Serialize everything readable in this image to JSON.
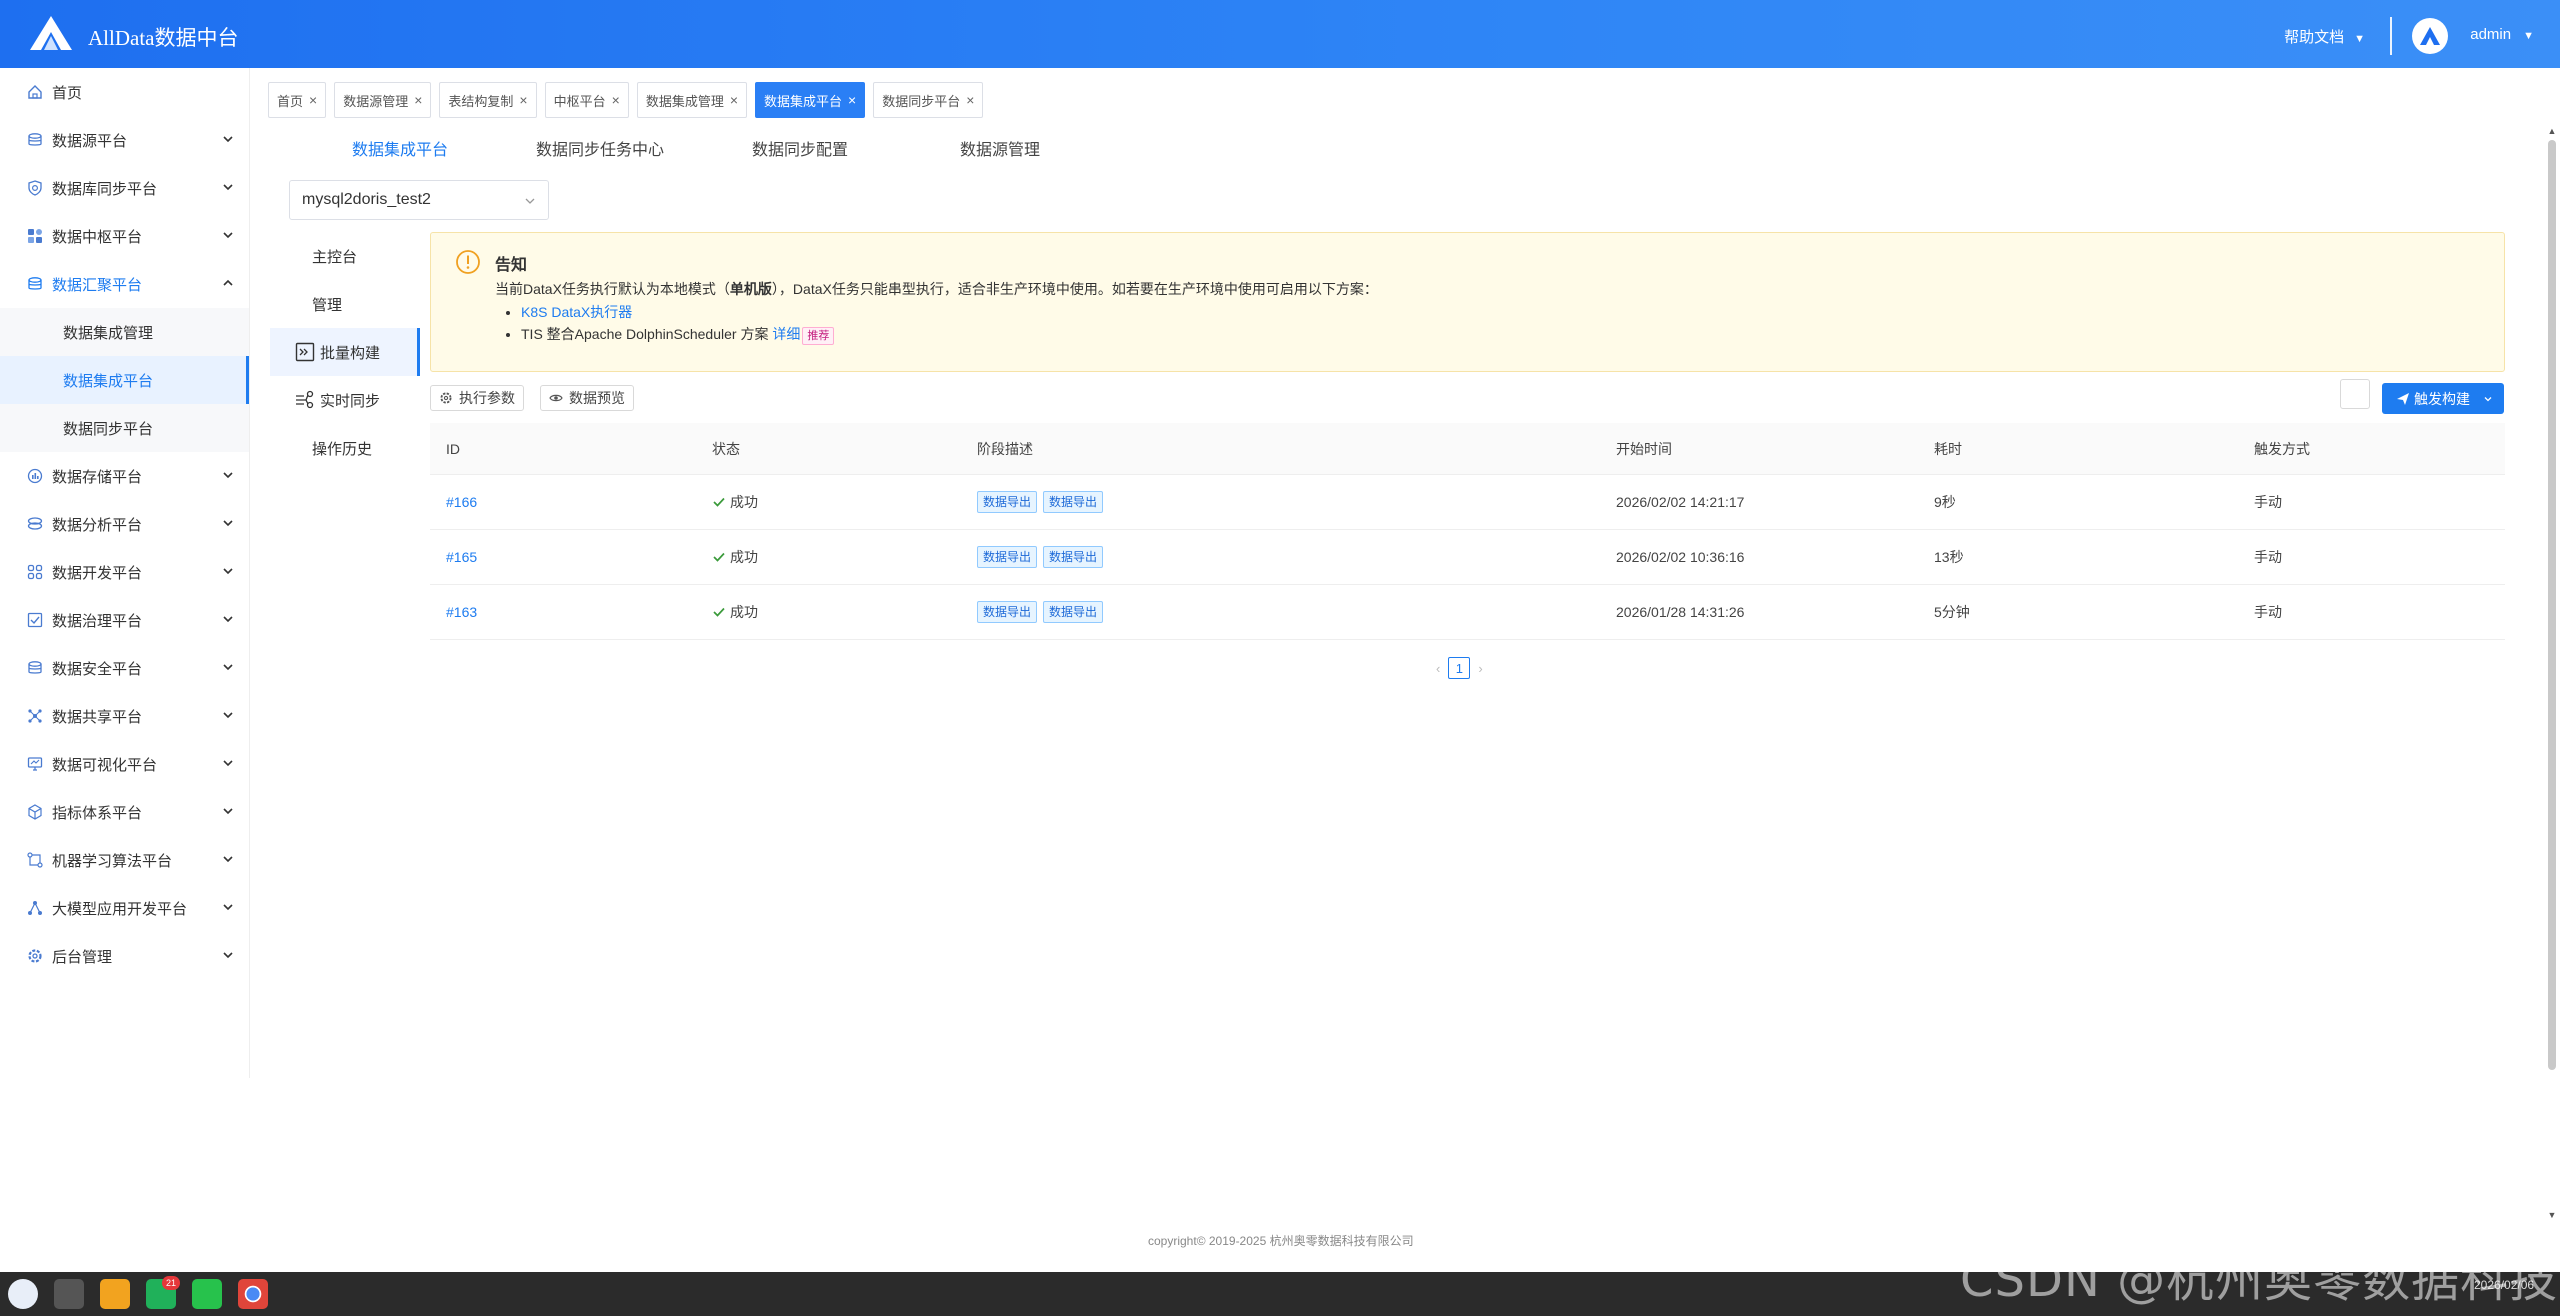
{
  "header": {
    "app_title": "AllData数据中台",
    "help_label": "帮助文档",
    "user_name": "admin"
  },
  "sidebar": {
    "items": [
      {
        "label": "首页",
        "icon": "home-icon"
      },
      {
        "label": "数据源平台",
        "icon": "database-icon"
      },
      {
        "label": "数据库同步平台",
        "icon": "sync-shield-icon"
      },
      {
        "label": "数据中枢平台",
        "icon": "hub-icon"
      },
      {
        "label": "数据汇聚平台",
        "icon": "database-icon",
        "expanded": true
      },
      {
        "label": "数据存储平台",
        "icon": "storage-icon"
      },
      {
        "label": "数据分析平台",
        "icon": "analysis-icon"
      },
      {
        "label": "数据开发平台",
        "icon": "grid-icon"
      },
      {
        "label": "数据治理平台",
        "icon": "checklist-icon"
      },
      {
        "label": "数据安全平台",
        "icon": "database-icon"
      },
      {
        "label": "数据共享平台",
        "icon": "share-icon"
      },
      {
        "label": "数据可视化平台",
        "icon": "monitor-icon"
      },
      {
        "label": "指标体系平台",
        "icon": "cube-icon"
      },
      {
        "label": "机器学习算法平台",
        "icon": "ml-icon"
      },
      {
        "label": "大模型应用开发平台",
        "icon": "llm-icon"
      },
      {
        "label": "后台管理",
        "icon": "settings-icon"
      }
    ],
    "subitems": [
      "数据集成管理",
      "数据集成平台",
      "数据同步平台"
    ]
  },
  "tags": [
    {
      "label": "首页"
    },
    {
      "label": "数据源管理"
    },
    {
      "label": "表结构复制"
    },
    {
      "label": "中枢平台"
    },
    {
      "label": "数据集成管理"
    },
    {
      "label": "数据集成平台",
      "active": true
    },
    {
      "label": "数据同步平台"
    }
  ],
  "top_tabs": [
    "数据集成平台",
    "数据同步任务中心",
    "数据同步配置",
    "数据源管理"
  ],
  "pipeline_select": {
    "value": "mysql2doris_test2"
  },
  "inner_nav": [
    "主控台",
    "管理",
    "批量构建",
    "实时同步",
    "操作历史"
  ],
  "notice": {
    "title": "告知",
    "text_a": "当前DataX任务执行默认为本地模式（",
    "text_bold": "单机版",
    "text_b": "），DataX任务只能串型执行，适合非生产环境中使用。如若要在生产环境中使用可启用以下方案：",
    "item1_link": "K8S DataX执行器",
    "item2_text": "TIS 整合Apache DolphinScheduler 方案",
    "item2_link": "详细",
    "item2_badge": "推荐"
  },
  "toolbar": {
    "exec_params": "执行参数",
    "data_preview": "数据预览",
    "trigger_build": "触发构建"
  },
  "table": {
    "headers": [
      "ID",
      "状态",
      "阶段描述",
      "开始时间",
      "耗时",
      "触发方式"
    ],
    "rows": [
      {
        "id": "#166",
        "status": "成功",
        "stages": [
          "数据导出",
          "数据导出"
        ],
        "start": "2026/02/02 14:21:17",
        "duration": "9秒",
        "trigger": "手动"
      },
      {
        "id": "#165",
        "status": "成功",
        "stages": [
          "数据导出",
          "数据导出"
        ],
        "start": "2026/02/02 10:36:16",
        "duration": "13秒",
        "trigger": "手动"
      },
      {
        "id": "#163",
        "status": "成功",
        "stages": [
          "数据导出",
          "数据导出"
        ],
        "start": "2026/01/28 14:31:26",
        "duration": "5分钟",
        "trigger": "手动"
      }
    ]
  },
  "pagination": {
    "current": "1"
  },
  "footer": {
    "copyright": "copyright© 2019-2025 杭州奥零数据科技有限公司"
  },
  "taskbar": {
    "badge": "21",
    "time": "2026/02/06"
  },
  "watermark": "CSDN @杭州奥零数据科技",
  "colors": {
    "primary": "#1e7cf0",
    "header": "#2f86f6",
    "notice_bg": "#fffbe8"
  }
}
